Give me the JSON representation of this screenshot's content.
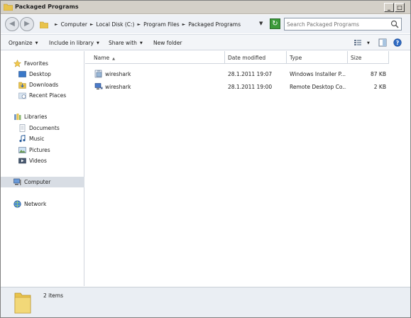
{
  "window": {
    "title": "Packaged Programs",
    "controls": {
      "minimize": "_",
      "maximize": "□",
      "close": "X"
    }
  },
  "address": {
    "breadcrumb": [
      "Computer",
      "Local Disk (C:)",
      "Program Files",
      "Packaged Programs"
    ],
    "search_placeholder": "Search Packaged Programs"
  },
  "toolbar": {
    "organize": "Organize",
    "include_in_library": "Include in library",
    "share_with": "Share with",
    "new_folder": "New folder"
  },
  "nav": {
    "favorites": "Favorites",
    "favorites_items": [
      "Desktop",
      "Downloads",
      "Recent Places"
    ],
    "libraries": "Libraries",
    "libraries_items": [
      "Documents",
      "Music",
      "Pictures",
      "Videos"
    ],
    "computer": "Computer",
    "network": "Network"
  },
  "columns": {
    "name": "Name",
    "date_modified": "Date modified",
    "type": "Type",
    "size": "Size"
  },
  "files": [
    {
      "name": "wireshark",
      "date_modified": "28.1.2011 19:07",
      "type": "Windows Installer P...",
      "size": "87 KB",
      "icon": "installer-icon"
    },
    {
      "name": "wireshark",
      "date_modified": "28.1.2011 19:00",
      "type": "Remote Desktop Co...",
      "size": "2 KB",
      "icon": "remote-desktop-icon"
    }
  ],
  "status": {
    "item_count": "2 items"
  },
  "colors": {
    "folder": "#e8c34c",
    "selected_nav": "#d8dde4",
    "refresh_green": "#3c9a3a"
  }
}
